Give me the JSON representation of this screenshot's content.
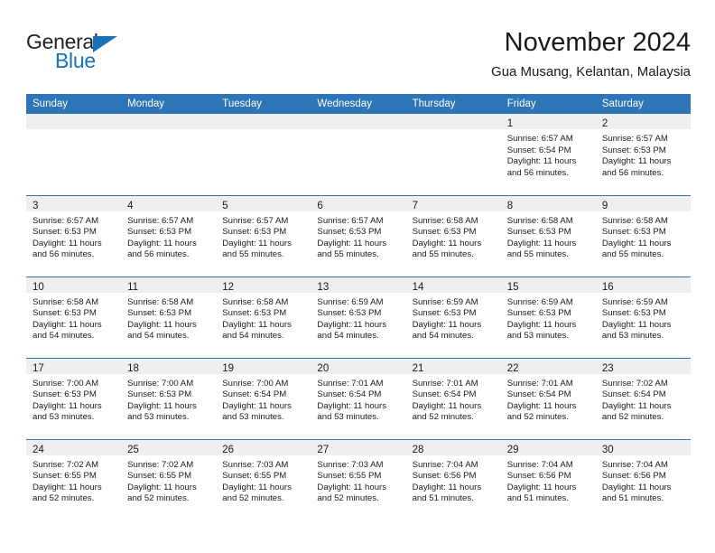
{
  "brand": {
    "name_top": "General",
    "name_bottom": "Blue",
    "triangle_color": "#1673bb",
    "top_color": "#231f20"
  },
  "header": {
    "title": "November 2024",
    "subtitle": "Gua Musang, Kelantan, Malaysia"
  },
  "colors": {
    "header_blue": "#2e75b6",
    "daynum_band": "#efefef",
    "text": "#1a1a1a"
  },
  "weekday_headers": [
    "Sunday",
    "Monday",
    "Tuesday",
    "Wednesday",
    "Thursday",
    "Friday",
    "Saturday"
  ],
  "weeks": [
    [
      {
        "empty": true
      },
      {
        "empty": true
      },
      {
        "empty": true
      },
      {
        "empty": true
      },
      {
        "empty": true
      },
      {
        "day": "1",
        "sunrise": "Sunrise: 6:57 AM",
        "sunset": "Sunset: 6:54 PM",
        "daylight1": "Daylight: 11 hours",
        "daylight2": "and 56 minutes."
      },
      {
        "day": "2",
        "sunrise": "Sunrise: 6:57 AM",
        "sunset": "Sunset: 6:53 PM",
        "daylight1": "Daylight: 11 hours",
        "daylight2": "and 56 minutes."
      }
    ],
    [
      {
        "day": "3",
        "sunrise": "Sunrise: 6:57 AM",
        "sunset": "Sunset: 6:53 PM",
        "daylight1": "Daylight: 11 hours",
        "daylight2": "and 56 minutes."
      },
      {
        "day": "4",
        "sunrise": "Sunrise: 6:57 AM",
        "sunset": "Sunset: 6:53 PM",
        "daylight1": "Daylight: 11 hours",
        "daylight2": "and 56 minutes."
      },
      {
        "day": "5",
        "sunrise": "Sunrise: 6:57 AM",
        "sunset": "Sunset: 6:53 PM",
        "daylight1": "Daylight: 11 hours",
        "daylight2": "and 55 minutes."
      },
      {
        "day": "6",
        "sunrise": "Sunrise: 6:57 AM",
        "sunset": "Sunset: 6:53 PM",
        "daylight1": "Daylight: 11 hours",
        "daylight2": "and 55 minutes."
      },
      {
        "day": "7",
        "sunrise": "Sunrise: 6:58 AM",
        "sunset": "Sunset: 6:53 PM",
        "daylight1": "Daylight: 11 hours",
        "daylight2": "and 55 minutes."
      },
      {
        "day": "8",
        "sunrise": "Sunrise: 6:58 AM",
        "sunset": "Sunset: 6:53 PM",
        "daylight1": "Daylight: 11 hours",
        "daylight2": "and 55 minutes."
      },
      {
        "day": "9",
        "sunrise": "Sunrise: 6:58 AM",
        "sunset": "Sunset: 6:53 PM",
        "daylight1": "Daylight: 11 hours",
        "daylight2": "and 55 minutes."
      }
    ],
    [
      {
        "day": "10",
        "sunrise": "Sunrise: 6:58 AM",
        "sunset": "Sunset: 6:53 PM",
        "daylight1": "Daylight: 11 hours",
        "daylight2": "and 54 minutes."
      },
      {
        "day": "11",
        "sunrise": "Sunrise: 6:58 AM",
        "sunset": "Sunset: 6:53 PM",
        "daylight1": "Daylight: 11 hours",
        "daylight2": "and 54 minutes."
      },
      {
        "day": "12",
        "sunrise": "Sunrise: 6:58 AM",
        "sunset": "Sunset: 6:53 PM",
        "daylight1": "Daylight: 11 hours",
        "daylight2": "and 54 minutes."
      },
      {
        "day": "13",
        "sunrise": "Sunrise: 6:59 AM",
        "sunset": "Sunset: 6:53 PM",
        "daylight1": "Daylight: 11 hours",
        "daylight2": "and 54 minutes."
      },
      {
        "day": "14",
        "sunrise": "Sunrise: 6:59 AM",
        "sunset": "Sunset: 6:53 PM",
        "daylight1": "Daylight: 11 hours",
        "daylight2": "and 54 minutes."
      },
      {
        "day": "15",
        "sunrise": "Sunrise: 6:59 AM",
        "sunset": "Sunset: 6:53 PM",
        "daylight1": "Daylight: 11 hours",
        "daylight2": "and 53 minutes."
      },
      {
        "day": "16",
        "sunrise": "Sunrise: 6:59 AM",
        "sunset": "Sunset: 6:53 PM",
        "daylight1": "Daylight: 11 hours",
        "daylight2": "and 53 minutes."
      }
    ],
    [
      {
        "day": "17",
        "sunrise": "Sunrise: 7:00 AM",
        "sunset": "Sunset: 6:53 PM",
        "daylight1": "Daylight: 11 hours",
        "daylight2": "and 53 minutes."
      },
      {
        "day": "18",
        "sunrise": "Sunrise: 7:00 AM",
        "sunset": "Sunset: 6:53 PM",
        "daylight1": "Daylight: 11 hours",
        "daylight2": "and 53 minutes."
      },
      {
        "day": "19",
        "sunrise": "Sunrise: 7:00 AM",
        "sunset": "Sunset: 6:54 PM",
        "daylight1": "Daylight: 11 hours",
        "daylight2": "and 53 minutes."
      },
      {
        "day": "20",
        "sunrise": "Sunrise: 7:01 AM",
        "sunset": "Sunset: 6:54 PM",
        "daylight1": "Daylight: 11 hours",
        "daylight2": "and 53 minutes."
      },
      {
        "day": "21",
        "sunrise": "Sunrise: 7:01 AM",
        "sunset": "Sunset: 6:54 PM",
        "daylight1": "Daylight: 11 hours",
        "daylight2": "and 52 minutes."
      },
      {
        "day": "22",
        "sunrise": "Sunrise: 7:01 AM",
        "sunset": "Sunset: 6:54 PM",
        "daylight1": "Daylight: 11 hours",
        "daylight2": "and 52 minutes."
      },
      {
        "day": "23",
        "sunrise": "Sunrise: 7:02 AM",
        "sunset": "Sunset: 6:54 PM",
        "daylight1": "Daylight: 11 hours",
        "daylight2": "and 52 minutes."
      }
    ],
    [
      {
        "day": "24",
        "sunrise": "Sunrise: 7:02 AM",
        "sunset": "Sunset: 6:55 PM",
        "daylight1": "Daylight: 11 hours",
        "daylight2": "and 52 minutes."
      },
      {
        "day": "25",
        "sunrise": "Sunrise: 7:02 AM",
        "sunset": "Sunset: 6:55 PM",
        "daylight1": "Daylight: 11 hours",
        "daylight2": "and 52 minutes."
      },
      {
        "day": "26",
        "sunrise": "Sunrise: 7:03 AM",
        "sunset": "Sunset: 6:55 PM",
        "daylight1": "Daylight: 11 hours",
        "daylight2": "and 52 minutes."
      },
      {
        "day": "27",
        "sunrise": "Sunrise: 7:03 AM",
        "sunset": "Sunset: 6:55 PM",
        "daylight1": "Daylight: 11 hours",
        "daylight2": "and 52 minutes."
      },
      {
        "day": "28",
        "sunrise": "Sunrise: 7:04 AM",
        "sunset": "Sunset: 6:56 PM",
        "daylight1": "Daylight: 11 hours",
        "daylight2": "and 51 minutes."
      },
      {
        "day": "29",
        "sunrise": "Sunrise: 7:04 AM",
        "sunset": "Sunset: 6:56 PM",
        "daylight1": "Daylight: 11 hours",
        "daylight2": "and 51 minutes."
      },
      {
        "day": "30",
        "sunrise": "Sunrise: 7:04 AM",
        "sunset": "Sunset: 6:56 PM",
        "daylight1": "Daylight: 11 hours",
        "daylight2": "and 51 minutes."
      }
    ]
  ]
}
